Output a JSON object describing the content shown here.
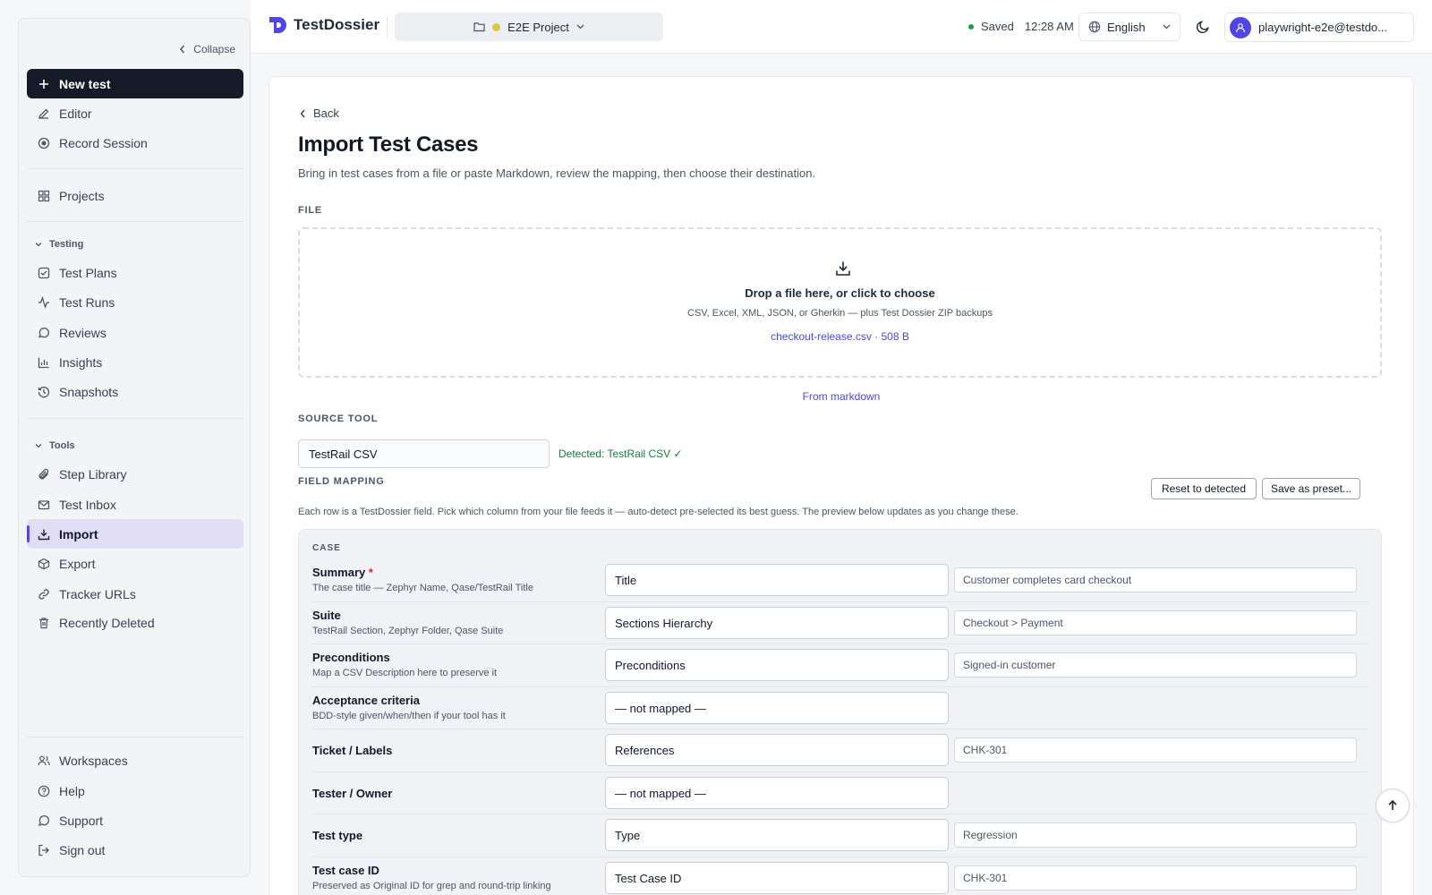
{
  "sidebar": {
    "collapse_label": "Collapse",
    "new_test": "New test",
    "items_top": [
      {
        "label": "Editor",
        "icon": "pencil-icon"
      },
      {
        "label": "Record Session",
        "icon": "record-icon"
      }
    ],
    "projects": "Projects",
    "testing_section": "Testing",
    "testing_items": [
      "Test Plans",
      "Test Runs",
      "Reviews",
      "Insights",
      "Snapshots"
    ],
    "tools_section": "Tools",
    "tools_items": [
      "Step Library",
      "Test Inbox",
      "Import",
      "Export",
      "Tracker URLs",
      "Recently Deleted"
    ],
    "bottom_items": [
      "Workspaces",
      "Help",
      "Support",
      "Sign out"
    ],
    "active_item": "Import"
  },
  "header": {
    "app_name": "TestDossier",
    "project": "E2E Project",
    "saved_label": "Saved",
    "time": "12:28 AM",
    "language": "English",
    "user_email": "playwright-e2e@testdo..."
  },
  "page": {
    "back_label": "Back",
    "title": "Import Test Cases",
    "subtitle": "Bring in test cases from a file or paste Markdown, review the mapping, then choose their destination.",
    "file_label": "FILE",
    "dropzone_title": "Drop a file here, or click to choose",
    "dropzone_hint": "CSV, Excel, XML, JSON, or Gherkin — plus Test Dossier ZIP backups",
    "selected_file": "checkout-release.csv · 508 B",
    "markdown_link": "From markdown",
    "source_tool_label": "SOURCE TOOL",
    "source_tool_value": "TestRail CSV",
    "detected_text": "Detected: TestRail CSV ✓",
    "field_mapping_label": "FIELD MAPPING",
    "reset_button": "Reset to detected",
    "save_preset_button": "Save as preset...",
    "mapping_hint": "Each row is a TestDossier field. Pick which column from your file feeds it — auto-detect pre-selected its best guess. The preview below updates as you change these.",
    "case_label": "CASE",
    "rows": [
      {
        "name": "Summary",
        "required": "*",
        "desc": "The case title — Zephyr Name, Qase/TestRail Title",
        "mapped": "Title",
        "preview": "Customer completes card checkout"
      },
      {
        "name": "Suite",
        "required": "",
        "desc": "TestRail Section, Zephyr Folder, Qase Suite",
        "mapped": "Sections Hierarchy",
        "preview": "Checkout > Payment"
      },
      {
        "name": "Preconditions",
        "required": "",
        "desc": "Map a CSV Description here to preserve it",
        "mapped": "Preconditions",
        "preview": "Signed-in customer"
      },
      {
        "name": "Acceptance criteria",
        "required": "",
        "desc": "BDD-style given/when/then if your tool has it",
        "mapped": "— not mapped —",
        "preview": ""
      },
      {
        "name": "Ticket / Labels",
        "required": "",
        "desc": "",
        "mapped": "References",
        "preview": "CHK-301"
      },
      {
        "name": "Tester / Owner",
        "required": "",
        "desc": "",
        "mapped": "— not mapped —",
        "preview": ""
      },
      {
        "name": "Test type",
        "required": "",
        "desc": "",
        "mapped": "Type",
        "preview": "Regression"
      },
      {
        "name": "Test case ID",
        "required": "",
        "desc": "Preserved as Original ID for grep and round-trip linking",
        "mapped": "Test Case ID",
        "preview": "CHK-301"
      }
    ]
  },
  "colors": {
    "accent": "#4f46e5",
    "primary_button": "#141a26",
    "active_nav_bg": "#e0ddf4",
    "success": "#15803d"
  }
}
